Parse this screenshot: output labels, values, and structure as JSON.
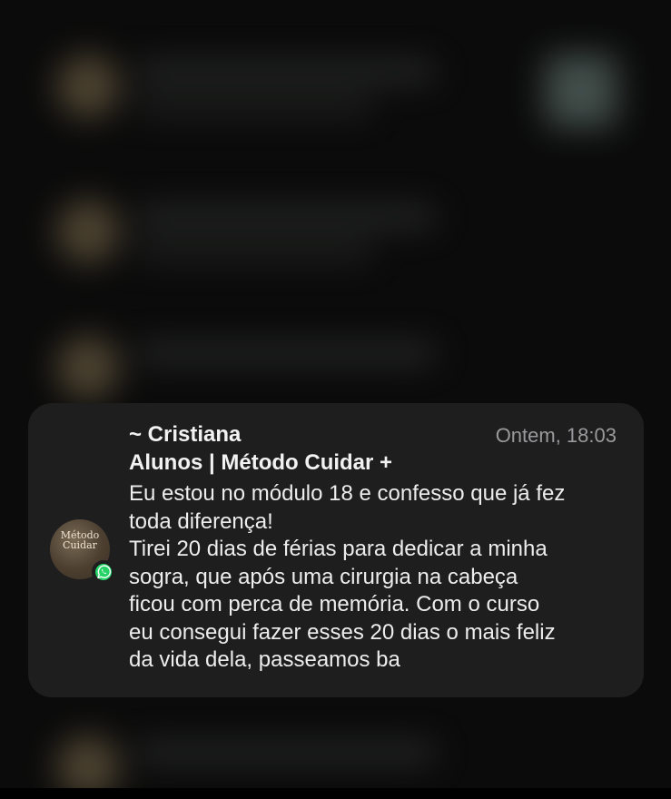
{
  "notification": {
    "sender": "~ Cristiana",
    "time": "Ontem, 18:03",
    "group": "Alunos | Método Cuidar +",
    "message_lines": [
      "Eu estou no módulo 18 e confesso que já fez",
      "toda diferença!",
      "Tirei 20 dias de férias para dedicar a minha",
      "sogra, que após uma cirurgia na cabeça",
      "ficou com perca de memória. Com o curso",
      "eu consegui fazer esses 20 dias o mais feliz",
      "da vida dela, passeamos ba"
    ],
    "avatar_text": "Método Cuidar",
    "app_icon": "whatsapp-icon",
    "colors": {
      "card_bg": "#1e1e1f",
      "text_primary": "#f2f2f2",
      "text_secondary": "#9a9a9c",
      "whatsapp_green": "#25d366"
    }
  }
}
